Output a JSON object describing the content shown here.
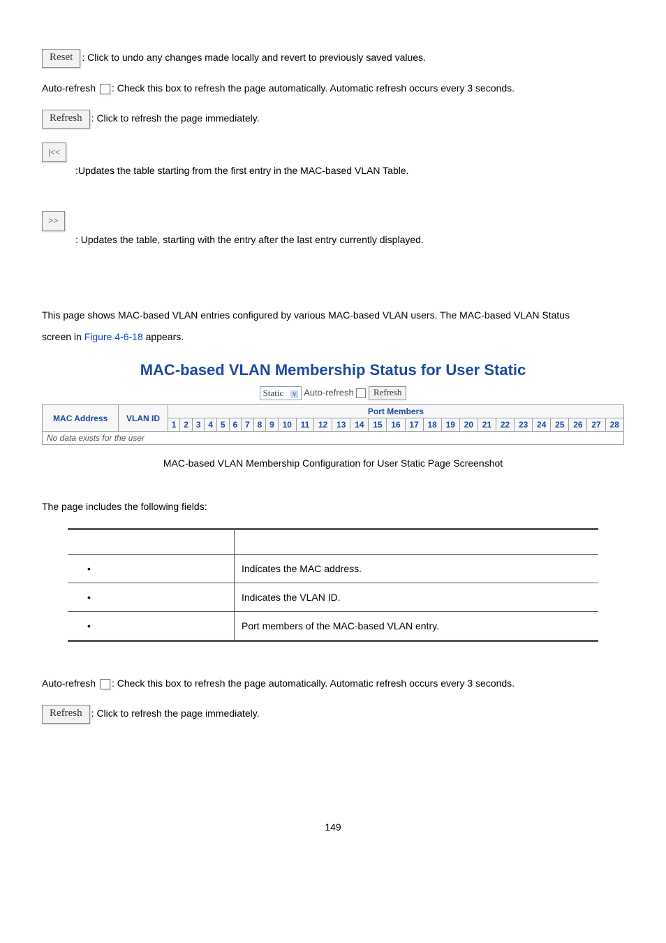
{
  "buttons": {
    "reset": "Reset",
    "refresh": "Refresh",
    "first": "|<<",
    "next": ">>"
  },
  "text": {
    "reset_desc": ": Click to undo any changes made locally and revert to previously saved values.",
    "auto_refresh_label": "Auto-refresh",
    "auto_refresh_desc": ": Check this box to refresh the page automatically. Automatic refresh occurs every 3 seconds.",
    "refresh_desc_prefix": ": ",
    "refresh_desc": "Click to refresh the page immediately.",
    "first_desc": ":Updates the table starting from the first entry in the MAC-based VLAN Table.",
    "next_desc": ": Updates the table, starting with the entry after the last entry currently displayed.",
    "intro_1": "This page shows MAC-based VLAN entries configured by various MAC-based VLAN users. The MAC-based VLAN Status",
    "intro_2a": "screen in ",
    "intro_2b": "Figure 4-6-18",
    "intro_2c": " appears.",
    "fields_intro": "The page includes the following fields:"
  },
  "scr": {
    "title": "MAC-based VLAN Membership Status for User Static",
    "select_value": "Static",
    "auto_refresh": "Auto-refresh",
    "refresh_btn": "Refresh",
    "col_mac": "MAC Address",
    "col_vlan": "VLAN ID",
    "port_members": "Port Members",
    "ports": [
      "1",
      "2",
      "3",
      "4",
      "5",
      "6",
      "7",
      "8",
      "9",
      "10",
      "11",
      "12",
      "13",
      "14",
      "15",
      "16",
      "17",
      "18",
      "19",
      "20",
      "21",
      "22",
      "23",
      "24",
      "25",
      "26",
      "27",
      "28"
    ],
    "nodata": "No data exists for the user",
    "caption": "MAC-based VLAN Membership Configuration for User Static Page Screenshot"
  },
  "fields": {
    "rows": [
      {
        "desc": "Indicates the MAC address."
      },
      {
        "desc": "Indicates the VLAN ID."
      },
      {
        "desc": "Port members of the MAC-based VLAN entry."
      }
    ]
  },
  "page_number": "149"
}
